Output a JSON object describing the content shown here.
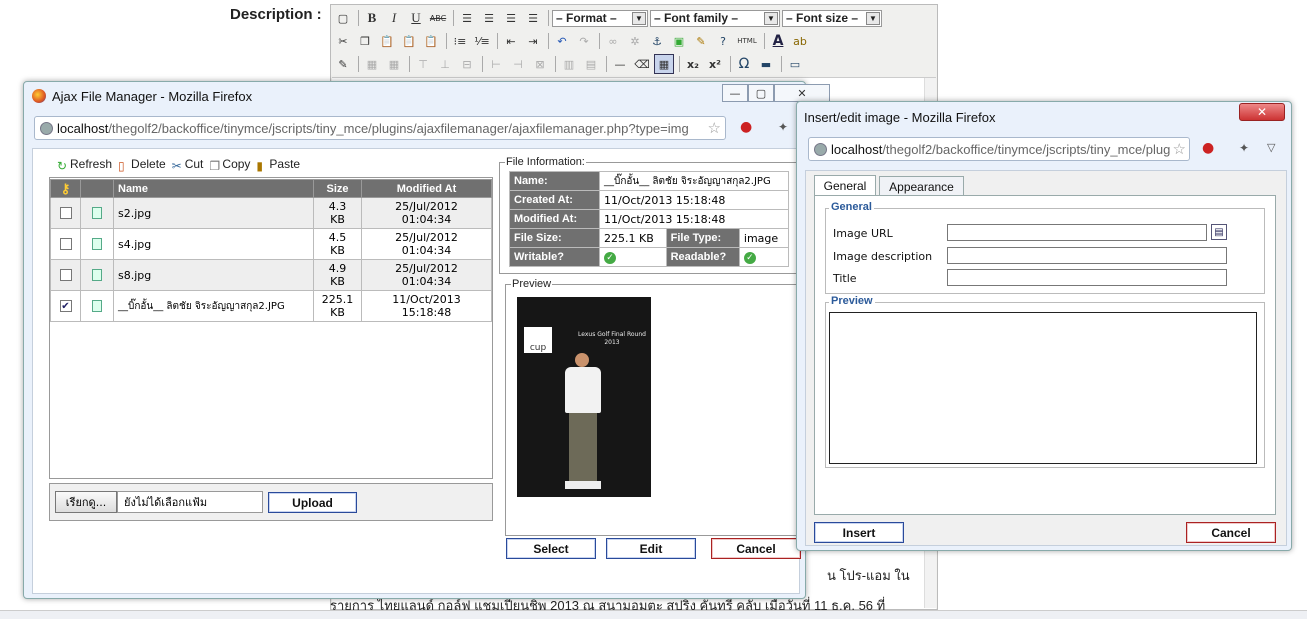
{
  "editor": {
    "description_label": "Description :",
    "format_select": "– Format –",
    "font_family_select": "– Font family –",
    "font_size_select": "– Font size –",
    "bottom_text": "รายการ ไทยแลนด์ กอล์ฟ แชมเปียนชิพ 2013 ณ สนามอมตะ สปริง คันทรี คลับ เมื่อวันที่ 11 ธ.ค. 56 ที่",
    "right_text": "น โปร-แอม ใน",
    "toolbar_row1": [
      "new-document-icon",
      "bold-icon",
      "italic-icon",
      "underline-icon",
      "strikethrough-icon",
      "align-left-icon",
      "align-center-icon",
      "align-right-icon",
      "align-justify-icon"
    ],
    "toolbar_row2": [
      "cut-icon",
      "copy-icon",
      "paste-icon",
      "paste-text-icon",
      "paste-word-icon",
      "bullet-list-icon",
      "numbered-list-icon",
      "outdent-icon",
      "indent-icon",
      "undo-icon",
      "redo-icon",
      "link-icon",
      "unlink-icon",
      "anchor-icon",
      "image-icon",
      "cleanup-icon",
      "help-icon",
      "html-icon",
      "text-color-icon",
      "highlight-color-icon"
    ],
    "toolbar_row3": [
      "edit-icon",
      "table-icon",
      "subscript-icon",
      "superscript-icon",
      "charmap-icon",
      "hr-icon",
      "fullscreen-icon"
    ],
    "html_btn": "HTML",
    "b": "B",
    "i": "I",
    "u": "U",
    "abc": "ABC",
    "sub": "x₂",
    "sup": "x²",
    "omega": "Ω"
  },
  "file_manager": {
    "title": "Ajax File Manager - Mozilla Firefox",
    "url_host": "localhost",
    "url_path": "/thegolf2/backoffice/tinymce/jscripts/tiny_mce/plugins/ajaxfilemanager/ajaxfilemanager.php?type=img",
    "toolbar": {
      "refresh": "Refresh",
      "delete": "Delete",
      "cut": "Cut",
      "copy": "Copy",
      "paste": "Paste"
    },
    "columns": {
      "name": "Name",
      "size": "Size",
      "modified": "Modified At"
    },
    "files": [
      {
        "name": "s2.jpg",
        "size1": "4.3",
        "size2": "KB",
        "date": "25/Jul/2012",
        "time": "01:04:34",
        "checked": false
      },
      {
        "name": "s4.jpg",
        "size1": "4.5",
        "size2": "KB",
        "date": "25/Jul/2012",
        "time": "01:04:34",
        "checked": false
      },
      {
        "name": "s8.jpg",
        "size1": "4.9",
        "size2": "KB",
        "date": "25/Jul/2012",
        "time": "01:04:34",
        "checked": false
      },
      {
        "name": "__บิ๊กอั้น__ ลิตชัย จิระอัญญาสกุล2.JPG",
        "size1": "225.1",
        "size2": "KB",
        "date": "11/Oct/2013",
        "time": "15:18:48",
        "checked": true
      }
    ],
    "browse_label": "เรียกดู...",
    "no_file_text": "ยังไม่ได้เลือกแฟ้ม",
    "upload_label": "Upload",
    "info": {
      "legend": "File Information:",
      "name_label": "Name:",
      "name_value": "__บิ๊กอั้น__ ลิตชัย จิระอัญญาสกุล2.JPG",
      "created_label": "Created At:",
      "created_value": "11/Oct/2013 15:18:48",
      "modified_label": "Modified At:",
      "modified_value": "11/Oct/2013 15:18:48",
      "size_label": "File Size:",
      "size_value": "225.1 KB",
      "type_label": "File Type:",
      "type_value": "image",
      "writable_label": "Writable?",
      "readable_label": "Readable?"
    },
    "preview_legend": "Preview",
    "photo_caption": "Lexus Golf Final Round 2013",
    "photo_logo": "cup",
    "select_label": "Select",
    "edit_label": "Edit",
    "cancel_label": "Cancel"
  },
  "insert_image": {
    "title": "Insert/edit image - Mozilla Firefox",
    "url_host": "localhost",
    "url_path": "/thegolf2/backoffice/tinymce/jscripts/tiny_mce/plug",
    "tabs": [
      "General",
      "Appearance"
    ],
    "general_legend": "General",
    "image_url_label": "Image URL",
    "image_url_value": "",
    "image_desc_label": "Image description",
    "image_desc_value": "",
    "title_label": "Title",
    "title_value": "",
    "preview_legend": "Preview",
    "insert_label": "Insert",
    "cancel_label": "Cancel",
    "close_glyph": "✕"
  }
}
